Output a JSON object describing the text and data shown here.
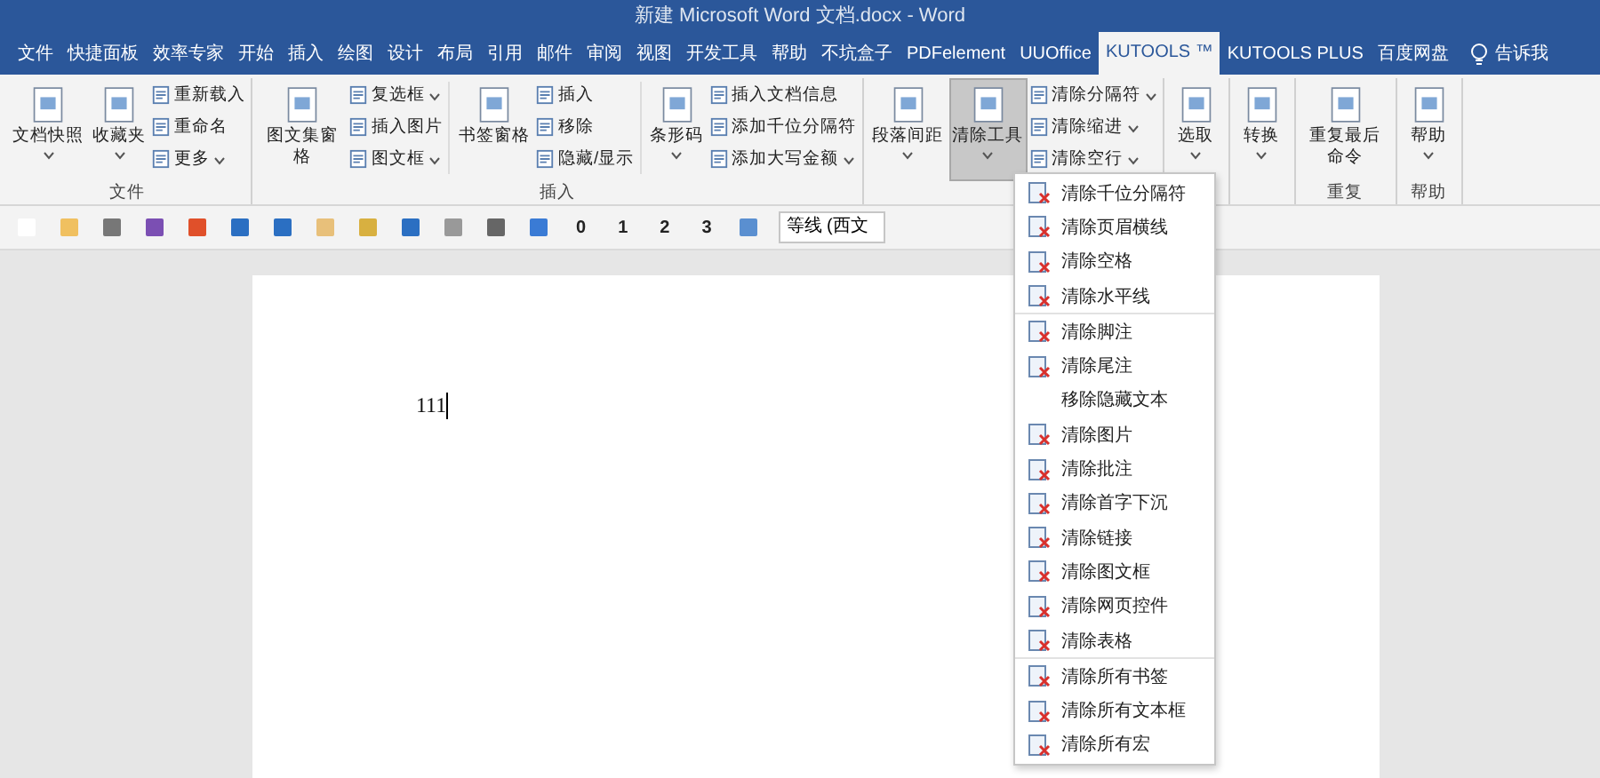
{
  "window": {
    "title": "新建 Microsoft Word 文档.docx  -  Word"
  },
  "tabs": [
    {
      "label": "文件",
      "selected": false
    },
    {
      "label": "快捷面板",
      "selected": false
    },
    {
      "label": "效率专家",
      "selected": false
    },
    {
      "label": "开始",
      "selected": false
    },
    {
      "label": "插入",
      "selected": false
    },
    {
      "label": "绘图",
      "selected": false
    },
    {
      "label": "设计",
      "selected": false
    },
    {
      "label": "布局",
      "selected": false
    },
    {
      "label": "引用",
      "selected": false
    },
    {
      "label": "邮件",
      "selected": false
    },
    {
      "label": "审阅",
      "selected": false
    },
    {
      "label": "视图",
      "selected": false
    },
    {
      "label": "开发工具",
      "selected": false
    },
    {
      "label": "帮助",
      "selected": false
    },
    {
      "label": "不坑盒子",
      "selected": false
    },
    {
      "label": "PDFelement",
      "selected": false
    },
    {
      "label": "UUOffice",
      "selected": false
    },
    {
      "label": "KUTOOLS ™",
      "selected": true
    },
    {
      "label": "KUTOOLS PLUS",
      "selected": false
    },
    {
      "label": "百度网盘",
      "selected": false
    }
  ],
  "tell_me": "告诉我",
  "ribbon": {
    "groups": [
      {
        "label": "文件",
        "items": [
          {
            "kind": "large",
            "label": "文档快照",
            "dropdown": true,
            "selected": false
          },
          {
            "kind": "large",
            "label": "收藏夹",
            "dropdown": true,
            "selected": false
          },
          {
            "kind": "small",
            "entries": [
              {
                "label": "重新载入",
                "dropdown": false
              },
              {
                "label": "重命名",
                "dropdown": false
              },
              {
                "label": "更多",
                "dropdown": true
              }
            ]
          }
        ]
      },
      {
        "label": "插入",
        "items": [
          {
            "kind": "large",
            "label": "图文集窗格",
            "dropdown": false,
            "selected": false
          },
          {
            "kind": "small",
            "entries": [
              {
                "label": "复选框",
                "dropdown": true
              },
              {
                "label": "插入图片",
                "dropdown": false
              },
              {
                "label": "图文框",
                "dropdown": true
              }
            ]
          },
          {
            "kind": "sep"
          },
          {
            "kind": "large",
            "label": "书签窗格",
            "dropdown": false,
            "selected": false
          },
          {
            "kind": "small",
            "entries": [
              {
                "label": "插入",
                "dropdown": false
              },
              {
                "label": "移除",
                "dropdown": false
              },
              {
                "label": "隐藏/显示",
                "dropdown": false
              }
            ]
          },
          {
            "kind": "sep"
          },
          {
            "kind": "large",
            "label": "条形码",
            "dropdown": true,
            "selected": false
          },
          {
            "kind": "small",
            "entries": [
              {
                "label": "插入文档信息",
                "dropdown": false
              },
              {
                "label": "添加千位分隔符",
                "dropdown": false
              },
              {
                "label": "添加大写金额",
                "dropdown": true
              }
            ]
          }
        ]
      },
      {
        "items": [
          {
            "kind": "large",
            "label": "段落间距",
            "dropdown": true,
            "selected": false
          },
          {
            "kind": "large",
            "label": "清除工具",
            "dropdown": true,
            "selected": true
          },
          {
            "kind": "small",
            "entries": [
              {
                "label": "清除分隔符",
                "dropdown": true
              },
              {
                "label": "清除缩进",
                "dropdown": true
              },
              {
                "label": "清除空行",
                "dropdown": true
              }
            ]
          }
        ]
      },
      {
        "items": [
          {
            "kind": "large",
            "label": "选取",
            "dropdown": true,
            "selected": false
          }
        ]
      },
      {
        "items": [
          {
            "kind": "large",
            "label": "转换",
            "dropdown": true,
            "selected": false
          }
        ]
      },
      {
        "label": "重复",
        "items": [
          {
            "kind": "large",
            "label": "重复最后命令",
            "dropdown": false,
            "selected": false
          }
        ]
      },
      {
        "label": "帮助",
        "items": [
          {
            "kind": "large",
            "label": "帮助",
            "dropdown": true,
            "selected": false
          }
        ]
      }
    ]
  },
  "toolbar": {
    "numbers": [
      "0",
      "1",
      "2",
      "3"
    ],
    "font": "等线 (西文"
  },
  "document": {
    "text": "111"
  },
  "menu": {
    "groups": [
      [
        {
          "label": "清除千位分隔符",
          "icon": true
        },
        {
          "label": "清除页眉横线",
          "icon": true
        },
        {
          "label": "清除空格",
          "icon": true
        },
        {
          "label": "清除水平线",
          "icon": true
        }
      ],
      [
        {
          "label": "清除脚注",
          "icon": true
        },
        {
          "label": "清除尾注",
          "icon": true
        },
        {
          "label": "移除隐藏文本",
          "icon": false
        },
        {
          "label": "清除图片",
          "icon": true
        },
        {
          "label": "清除批注",
          "icon": true
        },
        {
          "label": "清除首字下沉",
          "icon": true
        },
        {
          "label": "清除链接",
          "icon": true
        },
        {
          "label": "清除图文框",
          "icon": true
        },
        {
          "label": "清除网页控件",
          "icon": true
        },
        {
          "label": "清除表格",
          "icon": true
        }
      ],
      [
        {
          "label": "清除所有书签",
          "icon": true
        },
        {
          "label": "清除所有文本框",
          "icon": true
        },
        {
          "label": "清除所有宏",
          "icon": true
        }
      ]
    ]
  }
}
